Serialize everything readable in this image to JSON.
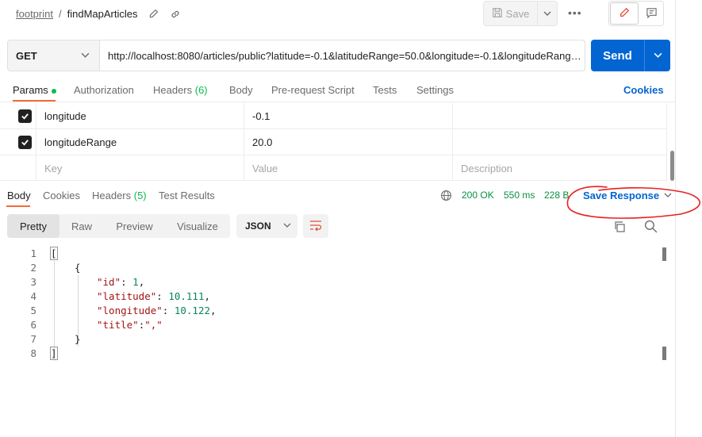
{
  "breadcrumb": {
    "workspace": "footprint",
    "separator": "/",
    "request_name": "findMapArticles"
  },
  "toolbar": {
    "save_label": "Save",
    "more_label": "•••"
  },
  "request": {
    "method": "GET",
    "url": "http://localhost:8080/articles/public?latitude=-0.1&latitudeRange=50.0&longitude=-0.1&longitudeRang…",
    "send_label": "Send"
  },
  "request_tabs": [
    {
      "label": "Params"
    },
    {
      "label": "Authorization"
    },
    {
      "label": "Headers ",
      "count": "(6)"
    },
    {
      "label": "Body"
    },
    {
      "label": "Pre-request Script"
    },
    {
      "label": "Tests"
    },
    {
      "label": "Settings"
    }
  ],
  "cookies_label": "Cookies",
  "params": {
    "rows": [
      {
        "key": "longitude",
        "value": "-0.1",
        "description": ""
      },
      {
        "key": "longitudeRange",
        "value": "20.0",
        "description": ""
      }
    ],
    "placeholders": {
      "key": "Key",
      "value": "Value",
      "description": "Description"
    }
  },
  "response_tabs": [
    {
      "label": "Body"
    },
    {
      "label": "Cookies"
    },
    {
      "label": "Headers ",
      "count": "(5)"
    },
    {
      "label": "Test Results"
    }
  ],
  "response_status": {
    "code": "200 OK",
    "time": "550 ms",
    "size": "228 B"
  },
  "save_response_label": "Save Response",
  "view_modes": [
    "Pretty",
    "Raw",
    "Preview",
    "Visualize"
  ],
  "format": "JSON",
  "code_lines": [
    {
      "n": "1"
    },
    {
      "n": "2"
    },
    {
      "n": "3"
    },
    {
      "n": "4"
    },
    {
      "n": "5"
    },
    {
      "n": "6"
    },
    {
      "n": "7"
    },
    {
      "n": "8"
    }
  ],
  "json_body": {
    "line1": "[",
    "line2": "{",
    "id_key": "\"id\"",
    "id_val": "1",
    "lat_key": "\"latitude\"",
    "lat_val": "10.111",
    "lon_key": "\"longitude\"",
    "lon_val": "10.122",
    "title_key": "\"title\"",
    "title_val": "\",\"",
    "line7": "}",
    "line8": "]"
  },
  "colors": {
    "accent": "#0265d2",
    "tab_underline": "#f26b3a",
    "status_green": "#0b8f41",
    "annotation": "#e8201f"
  }
}
